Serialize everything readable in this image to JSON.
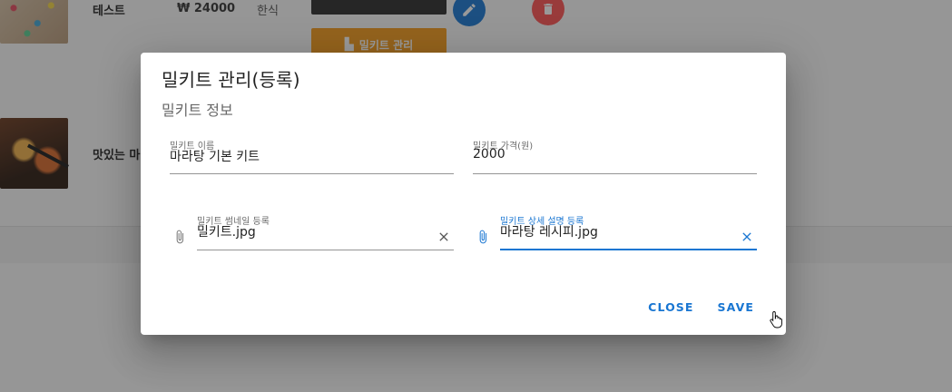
{
  "background": {
    "rows": [
      {
        "name": "테스트",
        "price": "₩ 24000",
        "category": "한식"
      },
      {
        "name": "맛있는 마"
      }
    ],
    "mealkit_manage_button": "밀키트 관리"
  },
  "dialog": {
    "title": "밀키트 관리(등록)",
    "subtitle": "밀키트 정보",
    "fields": {
      "name": {
        "label": "밀키트 이름",
        "value": "마라탕 기본 키트"
      },
      "price": {
        "label": "밀키트 가격(원)",
        "value": "2000"
      },
      "thumbnail": {
        "label": "밀키트 썸네일 등록",
        "value": "밀키트.jpg"
      },
      "detail": {
        "label": "밀키트 상세 설명 등록",
        "value": "마라탕 레시피.jpg"
      }
    },
    "actions": {
      "close": "CLOSE",
      "save": "SAVE"
    }
  },
  "colors": {
    "primary": "#1976d2",
    "orange": "#f59c1a",
    "danger": "#ff5252",
    "overlay": "rgba(33,33,33,0.46)"
  },
  "icons": [
    "pencil-icon",
    "trash-icon",
    "paperclip-icon",
    "close-icon",
    "hand-cursor-icon"
  ]
}
